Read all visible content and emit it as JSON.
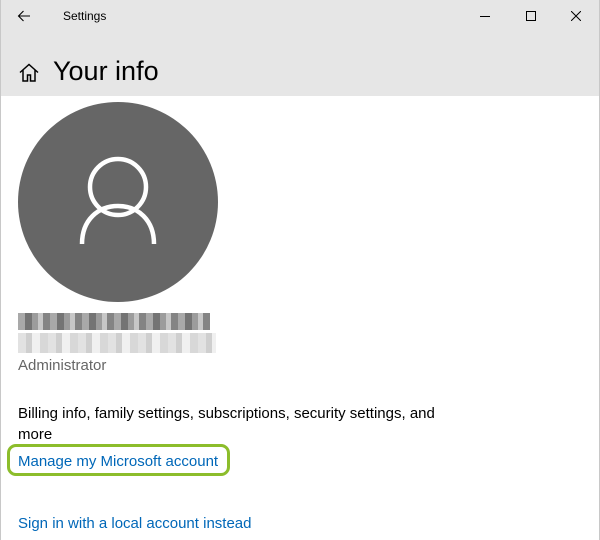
{
  "window": {
    "title": "Settings"
  },
  "header": {
    "title": "Your info"
  },
  "user": {
    "name": "",
    "email": "",
    "role": "Administrator"
  },
  "content": {
    "description": "Billing info, family settings, subscriptions, security settings, and more",
    "manage_link": "Manage my Microsoft account",
    "local_account_link": "Sign in with a local account instead"
  },
  "icons": {
    "back": "back-arrow-icon",
    "minimize": "minimize-icon",
    "maximize": "maximize-icon",
    "close": "close-icon",
    "home": "home-icon",
    "avatar": "person-icon"
  },
  "colors": {
    "titlebar": "#e6e6e6",
    "avatar_bg": "#666666",
    "link": "#0067b8",
    "highlight": "#8cbd2b",
    "secondary_text": "#666666"
  }
}
